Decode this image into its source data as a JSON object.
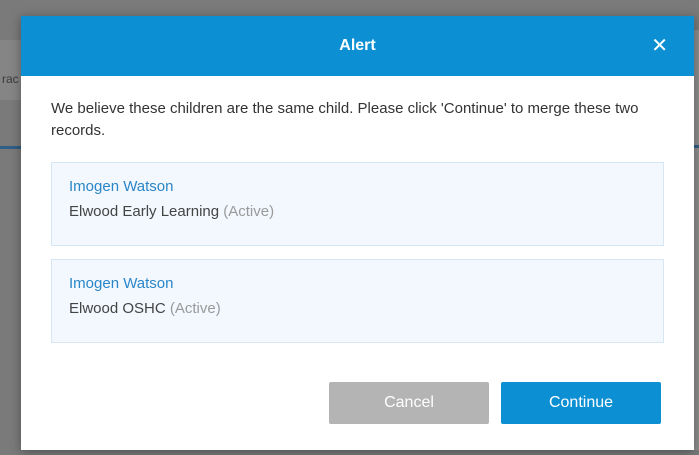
{
  "background": {
    "fragment_text": "rac"
  },
  "dialog": {
    "title": "Alert",
    "close_icon": "close-icon",
    "message": "We believe these children are the same child. Please click 'Continue' to merge these two records.",
    "records": [
      {
        "name": "Imogen Watson",
        "service": "Elwood Early Learning",
        "status": "(Active)"
      },
      {
        "name": "Imogen Watson",
        "service": "Elwood OSHC",
        "status": "(Active)"
      }
    ],
    "buttons": {
      "cancel_label": "Cancel",
      "continue_label": "Continue"
    }
  },
  "colors": {
    "header": "#0d8fd3",
    "primary_button": "#0d8fd3",
    "cancel_button": "#b4b4b4",
    "record_name": "#2a86c8",
    "record_bg": "#f2f8fd",
    "status_text": "#9a9a9a"
  }
}
